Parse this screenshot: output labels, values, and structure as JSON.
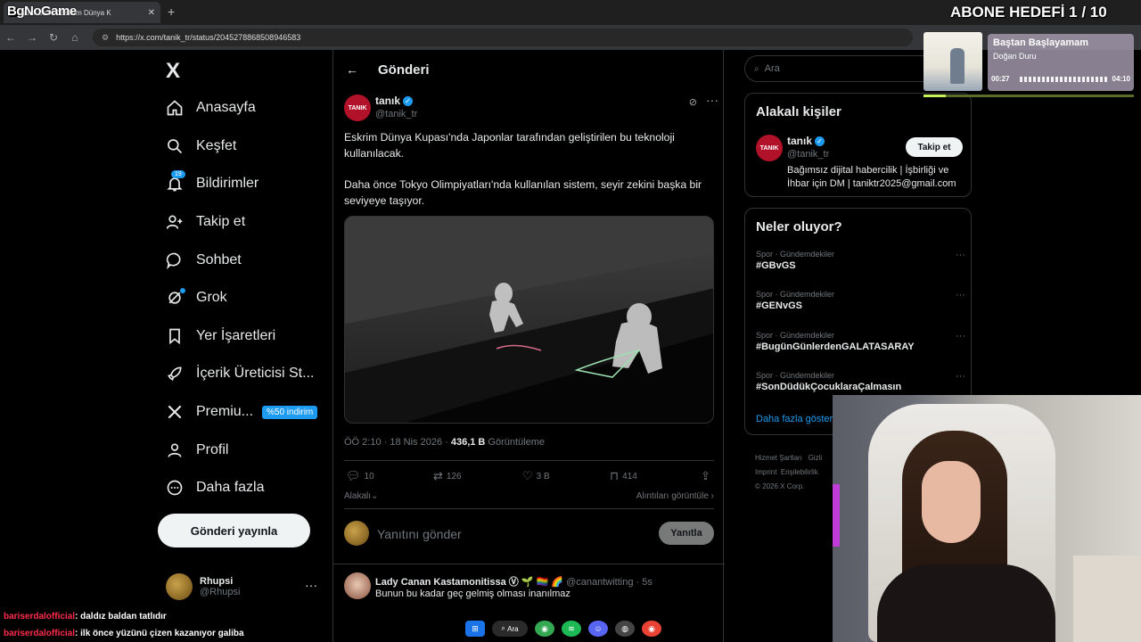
{
  "browser": {
    "tab_title": "tanık on X: \"Eskrim Dünya K",
    "brand_overlay": "BgNoGame",
    "url": "https://x.com/tanik_tr/status/2045278868508946583"
  },
  "stream": {
    "sub_goal": "ABONE HEDEFİ 1 / 10",
    "music": {
      "song": "Baştan Başlayamam",
      "artist": "Doğan Duru",
      "elapsed": "00:27",
      "total": "04:10",
      "progress": 0.108
    },
    "chat": [
      {
        "user": "bariserdalofficial",
        "message": ": daldız baldan tatlıdır"
      },
      {
        "user": "bariserdalofficial",
        "message": ": ilk önce yüzünü çizen kazanıyor galiba"
      }
    ],
    "taskbar": {
      "search_label": "Ara"
    }
  },
  "sidebar": {
    "logo": "X",
    "items": [
      {
        "label": "Anasayfa",
        "icon": "home-icon"
      },
      {
        "label": "Keşfet",
        "icon": "search-icon"
      },
      {
        "label": "Bildirimler",
        "icon": "bell-icon",
        "badge": "19"
      },
      {
        "label": "Takip et",
        "icon": "person-add-icon"
      },
      {
        "label": "Sohbet",
        "icon": "chat-icon"
      },
      {
        "label": "Grok",
        "icon": "grok-icon"
      },
      {
        "label": "Yer İşaretleri",
        "icon": "bookmark-icon"
      },
      {
        "label": "İçerik Üreticisi St...",
        "icon": "rocket-icon"
      },
      {
        "label": "Premiu...",
        "icon": "x-premium-icon",
        "badge": "%50 indirim"
      },
      {
        "label": "Profil",
        "icon": "profile-icon"
      },
      {
        "label": "Daha fazla",
        "icon": "more-circle-icon"
      }
    ],
    "post_button": "Gönderi yayınla",
    "account": {
      "name": "Rhupsi",
      "handle": "@Rhupsi"
    }
  },
  "main": {
    "title": "Gönderi",
    "tweet": {
      "author": "tanık",
      "handle": "@tanik_tr",
      "avatar_text": "TANIK",
      "text_1": "Eskrim Dünya Kupası'nda Japonlar tarafından geliştirilen bu teknoloji kullanılacak.",
      "text_2": "Daha önce Tokyo Olimpiyatları'nda kullanılan sistem, seyir zekini başka bir seviyeye taşıyor.",
      "timestamp": "ÖÖ 2:10 · 18 Nis 2026 · ",
      "views": "436,1 B",
      "views_label": " Görüntüleme",
      "replies": "10",
      "reposts": "126",
      "likes": "3 B",
      "bookmarks": "414",
      "sort_label": "Alakalı",
      "quotes_label": "Alıntıları görüntüle ›"
    },
    "reply_placeholder": "Yanıtını gönder",
    "reply_button": "Yanıtla",
    "first_reply": {
      "name": "Lady Canan Kastamonitissa Ⓥ 🌱 🏳️‍🌈 🌈",
      "handle": " @canantwitting · 5s",
      "text": "Bunun bu kadar geç gelmiş olması inanılmaz"
    }
  },
  "right": {
    "search_placeholder": "Ara",
    "related_title": "Alakalı kişiler",
    "related": {
      "name": "tanık",
      "handle": "@tanik_tr",
      "bio": "Bağımsız dijital habercilik | İşbirliği ve İhbar için DM | taniktr2025@gmail.com",
      "follow": "Takip et"
    },
    "trends_title": "Neler oluyor?",
    "trends": [
      {
        "category": "Spor · Gündemdekiler",
        "name": "#GBvGS"
      },
      {
        "category": "Spor · Gündemdekiler",
        "name": "#GENvGS"
      },
      {
        "category": "Spor · Gündemdekiler",
        "name": "#BugünGünlerdenGALATASARAY"
      },
      {
        "category": "Spor · Gündemdekiler",
        "name": "#SonDüdükÇocuklaraÇalmasın"
      }
    ],
    "show_more": "Daha fazla göster",
    "footer": [
      "Hizmet Şartları",
      "Gizli",
      "Imprint",
      "Erişilebilirlik",
      "© 2026 X Corp."
    ]
  }
}
